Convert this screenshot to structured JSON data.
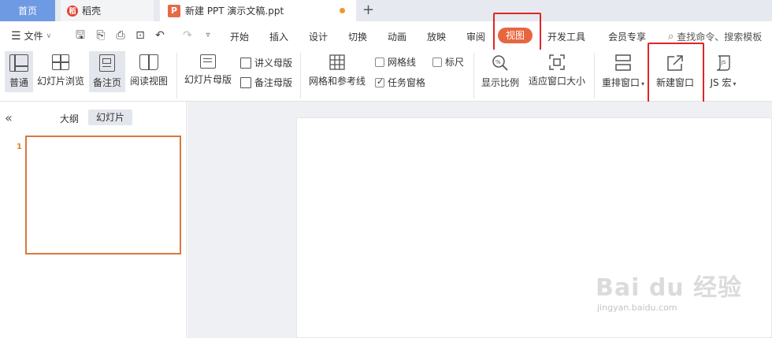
{
  "tabs": {
    "home": "首页",
    "docer": "稻壳",
    "doc": "新建 PPT 演示文稿.ppt",
    "add": "+"
  },
  "menu": {
    "file": "文件",
    "tabs": [
      "开始",
      "插入",
      "设计",
      "切换",
      "动画",
      "放映",
      "审阅",
      "视图",
      "开发工具",
      "会员专享"
    ],
    "search": "查找命令、搜索模板"
  },
  "ribbon": {
    "normal": "普通",
    "slide_browse": "幻灯片浏览",
    "notes_page": "备注页",
    "reading_view": "阅读视图",
    "slide_master": "幻灯片母版",
    "handout_master": "讲义母版",
    "notes_master": "备注母版",
    "grid_guides": "网格和参考线",
    "gridlines": "网格线",
    "ruler": "标尺",
    "task_pane": "任务窗格",
    "zoom": "显示比例",
    "fit_window": "适应窗口大小",
    "arrange_windows": "重排窗口",
    "new_window": "新建窗口",
    "js_macro": "JS 宏",
    "gridlines_checked": false,
    "ruler_checked": false,
    "task_pane_checked": true
  },
  "panel": {
    "outline": "大纲",
    "slides": "幻灯片",
    "slide_number": "1"
  },
  "watermark": {
    "brand": "Bai du 经验",
    "url": "jingyan.baidu.com"
  },
  "colors": {
    "accent_view": "#e8663f",
    "home_tab": "#6e9ae3",
    "highlight_box": "#e02525",
    "thumb_border": "#d9773d"
  }
}
